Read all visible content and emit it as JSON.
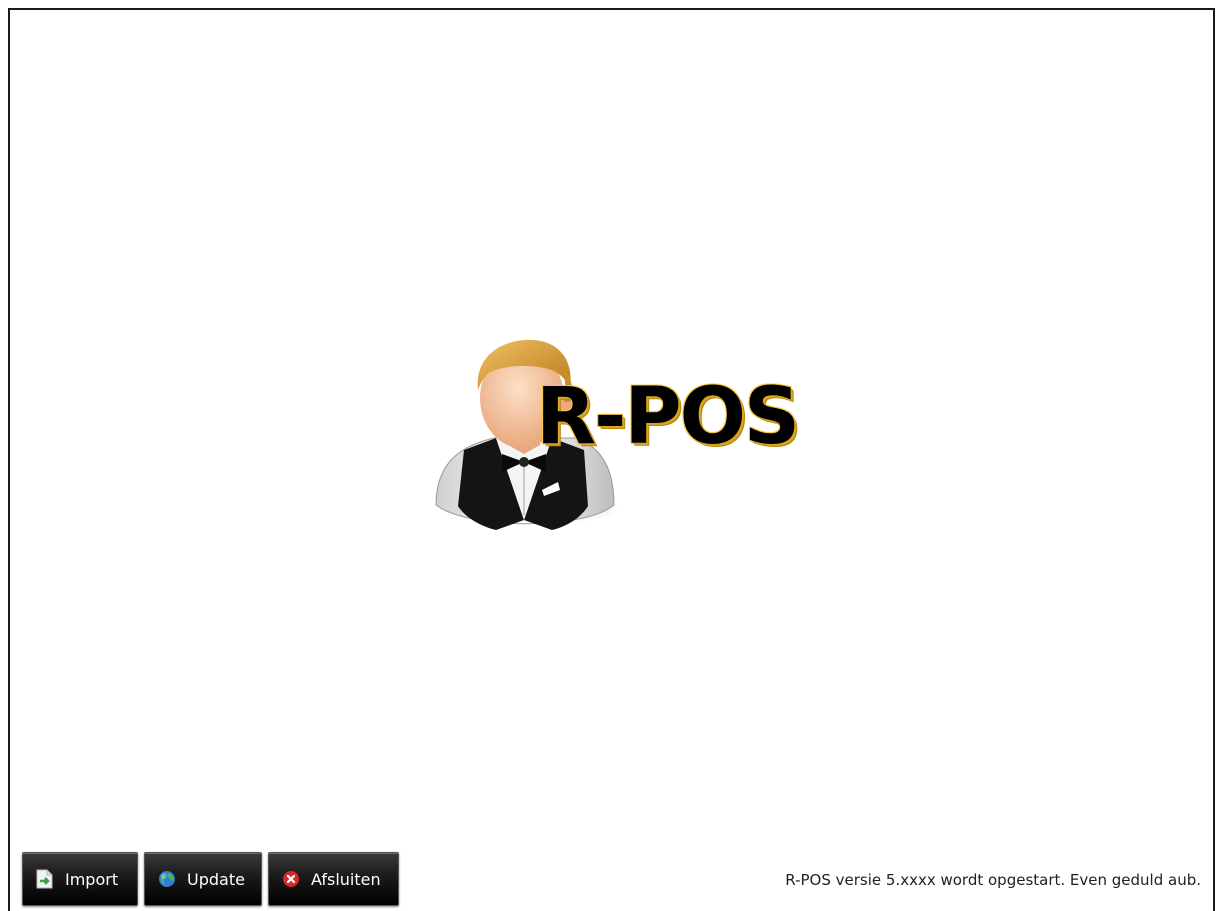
{
  "logo": {
    "brand": "R-POS",
    "mascot_icon": "waiter-icon",
    "colors": {
      "hair": "#d8a540",
      "skin": "#f6c9a8",
      "vest": "#111111",
      "shirt": "#f2f2f2",
      "brand_outline": "#d9a520"
    }
  },
  "toolbar": {
    "import_label": "Import",
    "import_icon": "import-document-icon",
    "update_label": "Update",
    "update_icon": "globe-icon",
    "exit_label": "Afsluiten",
    "exit_icon": "close-circle-icon"
  },
  "status": {
    "message": "R-POS versie 5.xxxx wordt opgestart. Even geduld aub."
  }
}
